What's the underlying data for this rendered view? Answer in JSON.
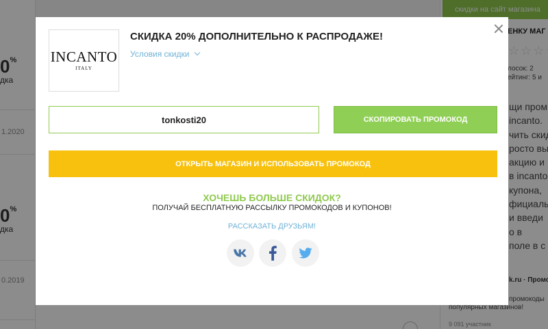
{
  "background": {
    "left_items": [
      {
        "pct": "0",
        "pct_sign": "%",
        "label": "дка",
        "date": "1.2020"
      },
      {
        "pct": "0",
        "pct_sign": "%",
        "label": "дка",
        "date": "0.2019"
      }
    ],
    "right_banner": "скидки на сайт магазина",
    "right_heading": "ЕНКУ МАГ",
    "right_votes": "лосок: 2",
    "right_rating": "ейтинг: 5 и",
    "right_paragraph": [
      "щи пром",
      "incanto.",
      "чить скидк",
      "росто вы",
      "акцию и",
      "в incanto",
      "купона,",
      "фициаль",
      "и введи",
      "о в",
      "поле в с"
    ],
    "right_footer_link": "k.ru · Промо",
    "right_footer_text": [
      "промокоды",
      "популярных магазинов!"
    ],
    "right_members": "9 091 участник"
  },
  "modal": {
    "logo": {
      "main": "INCANTO",
      "sub": "ITALY"
    },
    "title": "СКИДКА 20% ДОПОЛНИТЕЛЬНО К РАСПРОДАЖЕ!",
    "terms_label": "Условия скидки",
    "promo_code": "tonkosti20",
    "copy_button": "СКОПИРОВАТЬ ПРОМОКОД",
    "open_button": "ОТКРЫТЬ МАГАЗИН И ИСПОЛЬЗОВАТЬ ПРОМОКОД",
    "more_title": "ХОЧЕШЬ БОЛЬШЕ СКИДОК?",
    "more_subtitle": "ПОЛУЧАЙ БЕСПЛАТНУЮ РАССЫЛКУ ПРОМОКОДОВ И КУПОНОВ!",
    "share_label": "РАССКАЗАТЬ ДРУЗЬЯМ!",
    "social": [
      {
        "icon": "vk-icon",
        "color": "#4a76a8"
      },
      {
        "icon": "facebook-icon",
        "color": "#3b5998"
      },
      {
        "icon": "twitter-icon",
        "color": "#55acee"
      }
    ]
  },
  "colors": {
    "accent_green": "#8fc94e",
    "button_yellow": "#f8c10d",
    "link_blue": "#6fb1d6"
  }
}
